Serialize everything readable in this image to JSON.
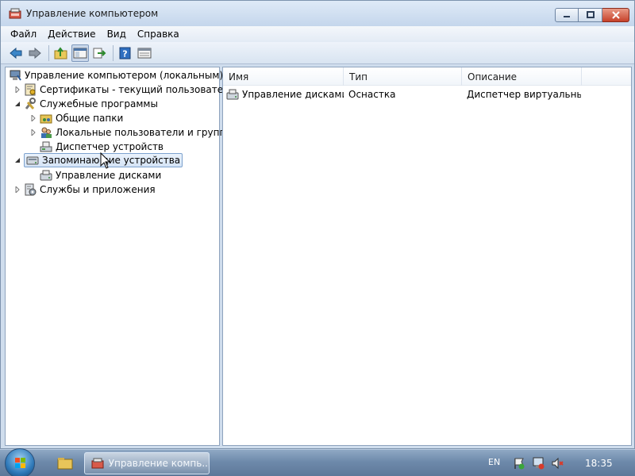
{
  "window": {
    "title": "Управление компьютером",
    "icon": "computer-management-icon"
  },
  "menu": [
    "Файл",
    "Действие",
    "Вид",
    "Справка"
  ],
  "toolbar": {
    "buttons": [
      "back-icon",
      "forward-icon",
      "up-folder-icon",
      "show-hide-tree-icon",
      "export-list-icon",
      "help-icon",
      "properties-icon"
    ]
  },
  "tree": {
    "root": "Управление компьютером (локальным)",
    "certificates": "Сертификаты - текущий пользователь",
    "system_tools": "Служебные программы",
    "shared_folders": "Общие папки",
    "local_users": "Локальные пользователи и группы",
    "device_manager": "Диспетчер устройств",
    "storage": "Запоминающие устройства",
    "disk_management": "Управление дисками",
    "services": "Службы и приложения"
  },
  "list": {
    "columns": [
      "Имя",
      "Тип",
      "Описание"
    ],
    "rows": [
      {
        "name": "Управление дисками...",
        "type": "Оснастка",
        "description": "Диспетчер виртуальны..."
      }
    ]
  },
  "taskbar": {
    "task_label": "Управление компь...",
    "language": "EN",
    "clock": "18:35"
  },
  "colors": {
    "accent": "#3a6ea5",
    "selection": "#d5e4f6",
    "close_button": "#c6412a"
  }
}
